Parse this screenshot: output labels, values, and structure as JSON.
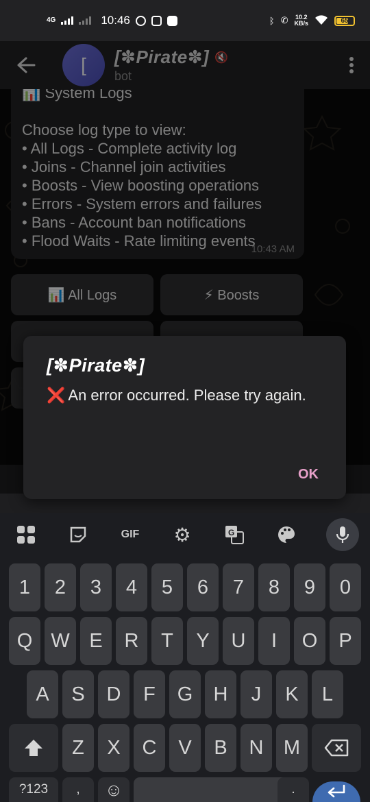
{
  "status_bar": {
    "network": "4G",
    "time": "10:46",
    "speed_value": "10.2",
    "speed_unit": "KB/s",
    "battery": "65"
  },
  "header": {
    "avatar_letter": "[",
    "bot_name": "[✽Pirate✽]",
    "subtitle": "bot"
  },
  "message": {
    "heading": "📊 System Logs",
    "lines": [
      "Choose log type to view:",
      "• All Logs - Complete activity log",
      "• Joins - Channel join activities",
      "• Boosts - View boosting operations",
      "• Errors - System errors and failures",
      "• Bans - Account ban notifications",
      "• Flood Waits - Rate limiting events"
    ],
    "time": "10:43 AM"
  },
  "inline_buttons": [
    {
      "label": "📊 All Logs"
    },
    {
      "label": "⚡ Boosts"
    }
  ],
  "dialog": {
    "title": "[✽Pirate✽]",
    "icon": "❌",
    "message": "An error occurred. Please try again.",
    "ok_label": "OK"
  },
  "keyboard": {
    "toolbar": [
      "grid-icon",
      "sticker-icon",
      "GIF",
      "gear-icon",
      "translate-icon",
      "palette-icon",
      "mic-icon"
    ],
    "gif_label": "GIF",
    "row_numbers": [
      "1",
      "2",
      "3",
      "4",
      "5",
      "6",
      "7",
      "8",
      "9",
      "0"
    ],
    "row_top": [
      "Q",
      "W",
      "E",
      "R",
      "T",
      "Y",
      "U",
      "I",
      "O",
      "P"
    ],
    "row_middle": [
      "A",
      "S",
      "D",
      "F",
      "G",
      "H",
      "J",
      "K",
      "L"
    ],
    "row_bottom": [
      "Z",
      "X",
      "C",
      "V",
      "B",
      "N",
      "M"
    ],
    "symbols_label": "?123",
    "comma": ",",
    "period": "."
  },
  "colors": {
    "accent_ok": "#e7a0c9",
    "error_red": "#e0302e",
    "enter_key": "#3f6bb0",
    "battery": "#f2c230"
  }
}
